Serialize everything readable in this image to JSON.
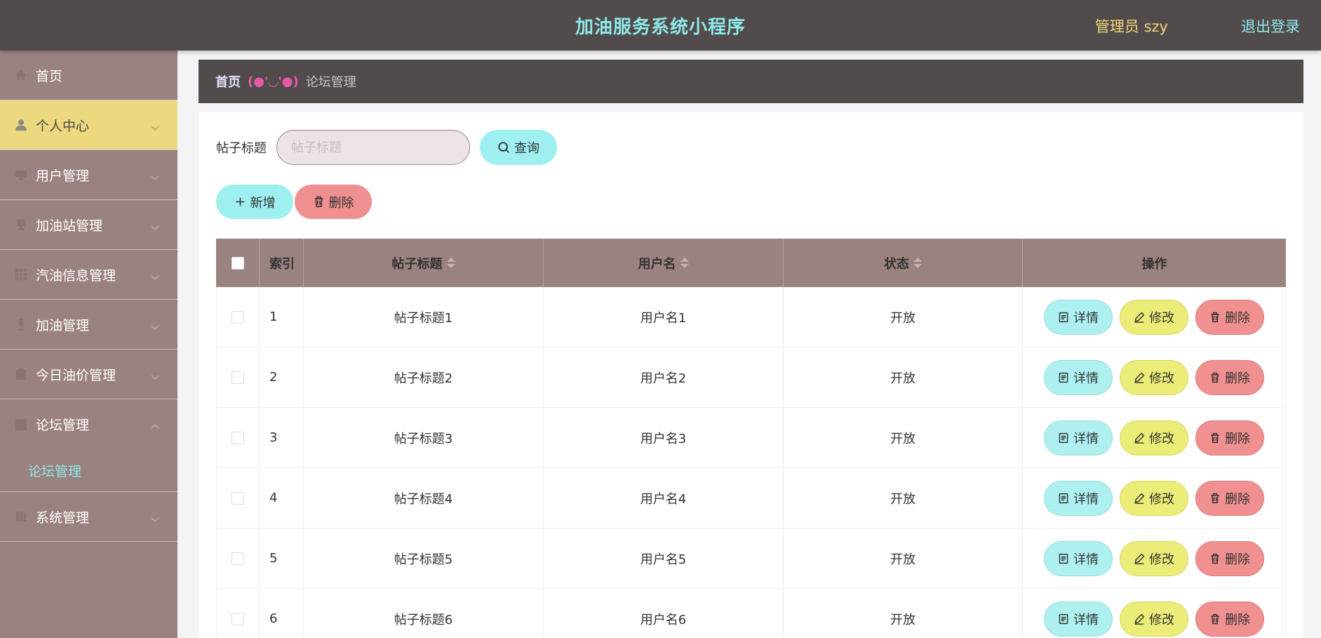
{
  "header": {
    "title": "加油服务系统小程序",
    "admin": "管理员 szy",
    "logout": "退出登录"
  },
  "sidebar": {
    "items": [
      {
        "label": "首页",
        "icon": "home-icon"
      },
      {
        "label": "个人中心",
        "icon": "person-icon"
      },
      {
        "label": "用户管理",
        "icon": "monitor-icon"
      },
      {
        "label": "加油站管理",
        "icon": "trophy-icon"
      },
      {
        "label": "汽油信息管理",
        "icon": "grid-icon"
      },
      {
        "label": "加油管理",
        "icon": "mic-icon"
      },
      {
        "label": "今日油价管理",
        "icon": "clipboard-icon"
      },
      {
        "label": "论坛管理",
        "icon": "chart-icon"
      },
      {
        "label": "系统管理",
        "icon": "book-icon"
      }
    ],
    "subitem": "论坛管理"
  },
  "breadcrumb": {
    "home": "首页",
    "separator": "(●'◡'●)",
    "current": "论坛管理"
  },
  "search": {
    "label": "帖子标题",
    "placeholder": "帖子标题",
    "query_btn": "查询"
  },
  "actions": {
    "add": "新增",
    "delete": "删除"
  },
  "table": {
    "headers": [
      "索引",
      "帖子标题",
      "用户名",
      "状态",
      "操作"
    ],
    "rows": [
      {
        "idx": "1",
        "title": "帖子标题1",
        "user": "用户名1",
        "status": "开放"
      },
      {
        "idx": "2",
        "title": "帖子标题2",
        "user": "用户名2",
        "status": "开放"
      },
      {
        "idx": "3",
        "title": "帖子标题3",
        "user": "用户名3",
        "status": "开放"
      },
      {
        "idx": "4",
        "title": "帖子标题4",
        "user": "用户名4",
        "status": "开放"
      },
      {
        "idx": "5",
        "title": "帖子标题5",
        "user": "用户名5",
        "status": "开放"
      },
      {
        "idx": "6",
        "title": "帖子标题6",
        "user": "用户名6",
        "status": "开放"
      }
    ],
    "ops": {
      "detail": "详情",
      "edit": "修改",
      "delete": "删除"
    }
  },
  "colors": {
    "header_bg": "#524b4b",
    "sidebar_bg": "#9a8280",
    "active_bg": "#ecd87e",
    "accent_cyan": "#9df0ef",
    "accent_yellow": "#ecec78",
    "accent_red": "#f08f8f"
  }
}
